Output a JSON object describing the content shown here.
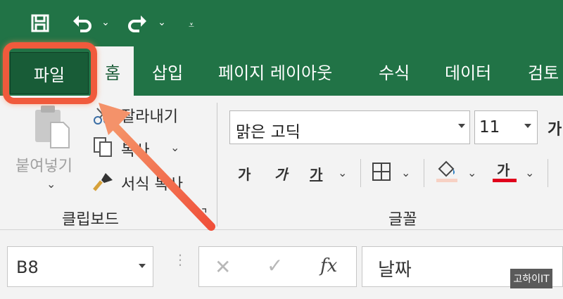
{
  "quick_access": {
    "icons": [
      "save-icon",
      "undo-icon",
      "redo-icon",
      "customize-icon"
    ]
  },
  "tabs": [
    {
      "label": "파일"
    },
    {
      "label": "홈"
    },
    {
      "label": "삽입"
    },
    {
      "label": "페이지 레이아웃"
    },
    {
      "label": "수식"
    },
    {
      "label": "데이터"
    },
    {
      "label": "검토"
    }
  ],
  "clipboard": {
    "paste_label": "붙여넣기",
    "cut_label": "잘라내기",
    "copy_label": "복사",
    "format_painter_label": "서식 복사",
    "group_label": "클립보드"
  },
  "font": {
    "font_name": "맑은 고딕",
    "font_size": "11",
    "bold_label": "가",
    "italic_label": "가",
    "underline_label": "가",
    "font_color_label": "가",
    "font_color": "#e0001b",
    "group_label": "글꼴",
    "grow_font_label": "가"
  },
  "formula_bar": {
    "name_box_value": "B8",
    "fx_label": "fx",
    "content": "날짜"
  },
  "watermark": "고하이IT",
  "colors": {
    "excel_green": "#217346",
    "file_tab": "#185c37",
    "highlight": "#f05a3c"
  }
}
